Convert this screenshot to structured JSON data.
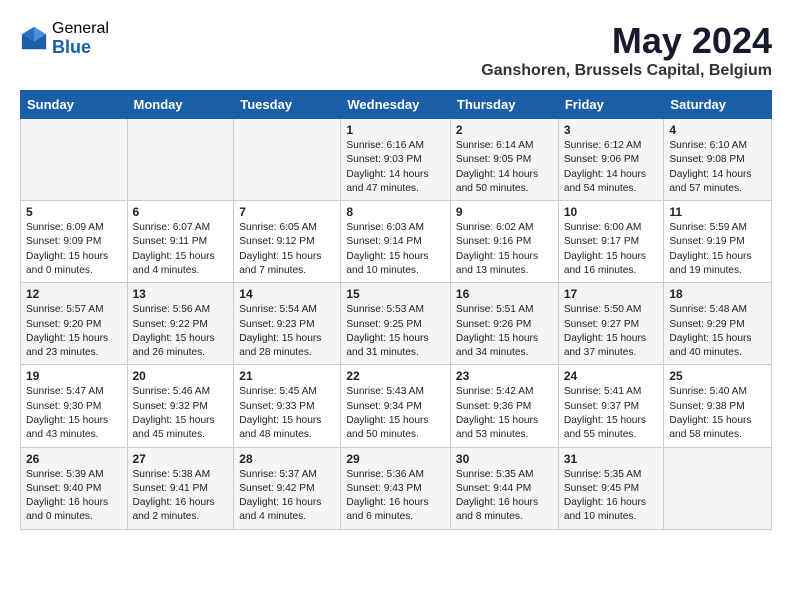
{
  "header": {
    "logo_general": "General",
    "logo_blue": "Blue",
    "month_year": "May 2024",
    "location": "Ganshoren, Brussels Capital, Belgium"
  },
  "weekdays": [
    "Sunday",
    "Monday",
    "Tuesday",
    "Wednesday",
    "Thursday",
    "Friday",
    "Saturday"
  ],
  "weeks": [
    [
      {
        "day": "",
        "content": ""
      },
      {
        "day": "",
        "content": ""
      },
      {
        "day": "",
        "content": ""
      },
      {
        "day": "1",
        "content": "Sunrise: 6:16 AM\nSunset: 9:03 PM\nDaylight: 14 hours\nand 47 minutes."
      },
      {
        "day": "2",
        "content": "Sunrise: 6:14 AM\nSunset: 9:05 PM\nDaylight: 14 hours\nand 50 minutes."
      },
      {
        "day": "3",
        "content": "Sunrise: 6:12 AM\nSunset: 9:06 PM\nDaylight: 14 hours\nand 54 minutes."
      },
      {
        "day": "4",
        "content": "Sunrise: 6:10 AM\nSunset: 9:08 PM\nDaylight: 14 hours\nand 57 minutes."
      }
    ],
    [
      {
        "day": "5",
        "content": "Sunrise: 6:09 AM\nSunset: 9:09 PM\nDaylight: 15 hours\nand 0 minutes."
      },
      {
        "day": "6",
        "content": "Sunrise: 6:07 AM\nSunset: 9:11 PM\nDaylight: 15 hours\nand 4 minutes."
      },
      {
        "day": "7",
        "content": "Sunrise: 6:05 AM\nSunset: 9:12 PM\nDaylight: 15 hours\nand 7 minutes."
      },
      {
        "day": "8",
        "content": "Sunrise: 6:03 AM\nSunset: 9:14 PM\nDaylight: 15 hours\nand 10 minutes."
      },
      {
        "day": "9",
        "content": "Sunrise: 6:02 AM\nSunset: 9:16 PM\nDaylight: 15 hours\nand 13 minutes."
      },
      {
        "day": "10",
        "content": "Sunrise: 6:00 AM\nSunset: 9:17 PM\nDaylight: 15 hours\nand 16 minutes."
      },
      {
        "day": "11",
        "content": "Sunrise: 5:59 AM\nSunset: 9:19 PM\nDaylight: 15 hours\nand 19 minutes."
      }
    ],
    [
      {
        "day": "12",
        "content": "Sunrise: 5:57 AM\nSunset: 9:20 PM\nDaylight: 15 hours\nand 23 minutes."
      },
      {
        "day": "13",
        "content": "Sunrise: 5:56 AM\nSunset: 9:22 PM\nDaylight: 15 hours\nand 26 minutes."
      },
      {
        "day": "14",
        "content": "Sunrise: 5:54 AM\nSunset: 9:23 PM\nDaylight: 15 hours\nand 28 minutes."
      },
      {
        "day": "15",
        "content": "Sunrise: 5:53 AM\nSunset: 9:25 PM\nDaylight: 15 hours\nand 31 minutes."
      },
      {
        "day": "16",
        "content": "Sunrise: 5:51 AM\nSunset: 9:26 PM\nDaylight: 15 hours\nand 34 minutes."
      },
      {
        "day": "17",
        "content": "Sunrise: 5:50 AM\nSunset: 9:27 PM\nDaylight: 15 hours\nand 37 minutes."
      },
      {
        "day": "18",
        "content": "Sunrise: 5:48 AM\nSunset: 9:29 PM\nDaylight: 15 hours\nand 40 minutes."
      }
    ],
    [
      {
        "day": "19",
        "content": "Sunrise: 5:47 AM\nSunset: 9:30 PM\nDaylight: 15 hours\nand 43 minutes."
      },
      {
        "day": "20",
        "content": "Sunrise: 5:46 AM\nSunset: 9:32 PM\nDaylight: 15 hours\nand 45 minutes."
      },
      {
        "day": "21",
        "content": "Sunrise: 5:45 AM\nSunset: 9:33 PM\nDaylight: 15 hours\nand 48 minutes."
      },
      {
        "day": "22",
        "content": "Sunrise: 5:43 AM\nSunset: 9:34 PM\nDaylight: 15 hours\nand 50 minutes."
      },
      {
        "day": "23",
        "content": "Sunrise: 5:42 AM\nSunset: 9:36 PM\nDaylight: 15 hours\nand 53 minutes."
      },
      {
        "day": "24",
        "content": "Sunrise: 5:41 AM\nSunset: 9:37 PM\nDaylight: 15 hours\nand 55 minutes."
      },
      {
        "day": "25",
        "content": "Sunrise: 5:40 AM\nSunset: 9:38 PM\nDaylight: 15 hours\nand 58 minutes."
      }
    ],
    [
      {
        "day": "26",
        "content": "Sunrise: 5:39 AM\nSunset: 9:40 PM\nDaylight: 16 hours\nand 0 minutes."
      },
      {
        "day": "27",
        "content": "Sunrise: 5:38 AM\nSunset: 9:41 PM\nDaylight: 16 hours\nand 2 minutes."
      },
      {
        "day": "28",
        "content": "Sunrise: 5:37 AM\nSunset: 9:42 PM\nDaylight: 16 hours\nand 4 minutes."
      },
      {
        "day": "29",
        "content": "Sunrise: 5:36 AM\nSunset: 9:43 PM\nDaylight: 16 hours\nand 6 minutes."
      },
      {
        "day": "30",
        "content": "Sunrise: 5:35 AM\nSunset: 9:44 PM\nDaylight: 16 hours\nand 8 minutes."
      },
      {
        "day": "31",
        "content": "Sunrise: 5:35 AM\nSunset: 9:45 PM\nDaylight: 16 hours\nand 10 minutes."
      },
      {
        "day": "",
        "content": ""
      }
    ]
  ]
}
